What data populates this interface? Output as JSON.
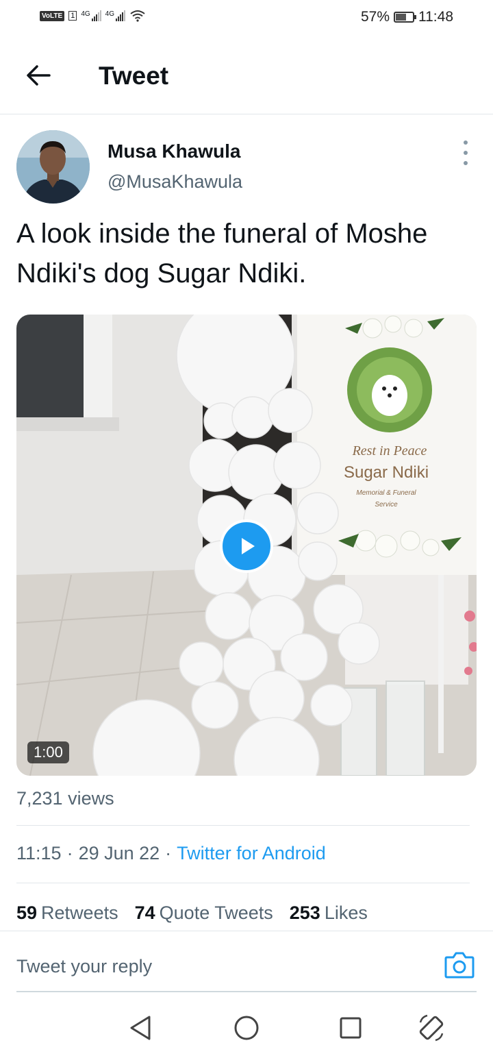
{
  "status_bar": {
    "volte": "VoLTE",
    "sim": "1",
    "network1": "4G",
    "network2": "4G",
    "battery_percent": "57%",
    "battery_level": 0.57,
    "time": "11:48"
  },
  "header": {
    "title": "Tweet"
  },
  "tweet": {
    "author_name": "Musa Khawula",
    "author_handle": "@MusaKhawula",
    "text": "A look inside the funeral of Moshe Ndiki's dog Sugar Ndiki.",
    "media": {
      "duration": "1:00",
      "sign_script": "Rest in Peace",
      "sign_name": "Sugar Ndiki",
      "sign_subtitle_1": "Memorial & Funeral",
      "sign_subtitle_2": "Service"
    },
    "views": "7,231 views",
    "time": "11:15",
    "separator": "·",
    "date": "29 Jun 22",
    "source": "Twitter for Android",
    "stats": {
      "retweets_count": "59",
      "retweets_label": "Retweets",
      "quotes_count": "74",
      "quotes_label": "Quote Tweets",
      "likes_count": "253",
      "likes_label": "Likes"
    }
  },
  "reply": {
    "placeholder": "Tweet your reply"
  },
  "icons": {
    "back": "arrow-left-icon",
    "more": "more-vertical-icon",
    "play": "play-icon",
    "camera": "camera-icon",
    "nav_back": "triangle-back-icon",
    "nav_home": "circle-home-icon",
    "nav_recents": "square-recents-icon",
    "rotate": "rotate-icon"
  },
  "colors": {
    "accent": "#1d9bf0",
    "text_primary": "#0f1419",
    "text_secondary": "#536471"
  }
}
